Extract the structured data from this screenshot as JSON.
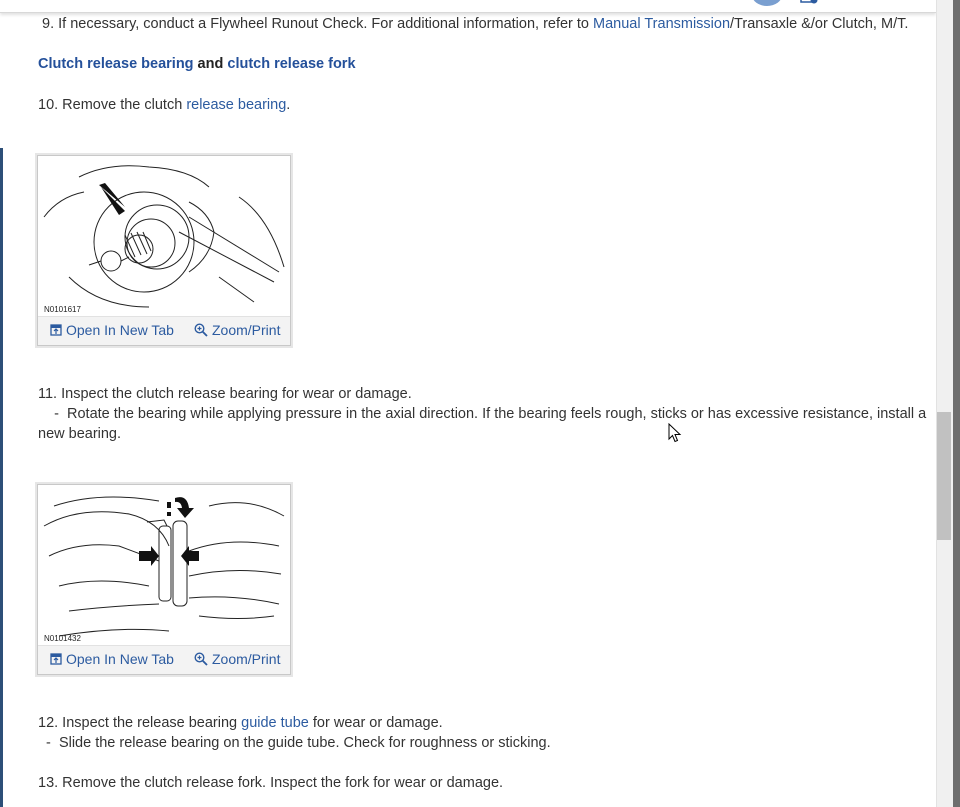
{
  "step9": {
    "prefix": " 9. If necessary, conduct a Flywheel Runout Check. For additional information, refer to ",
    "link": "Manual Transmission",
    "suffix": "/Transaxle &/or Clutch, M/T."
  },
  "heading": {
    "part1": "Clutch release bearing",
    "and": " and ",
    "part2": "clutch release fork"
  },
  "step10": {
    "prefix": "10. Remove the clutch ",
    "link": "release bearing",
    "suffix": "."
  },
  "figure1": {
    "code": "N0101617",
    "open_label": "Open In New Tab",
    "zoom_label": "Zoom/Print"
  },
  "step11": {
    "line1": "11. Inspect the clutch release bearing for wear or damage.",
    "line2": "    -  Rotate the bearing while applying pressure in the axial direction. If the bearing feels rough, sticks or has excessive resistance, install a",
    "line3": "new bearing."
  },
  "figure2": {
    "code": "N0101432",
    "open_label": "Open In New Tab",
    "zoom_label": "Zoom/Print"
  },
  "step12": {
    "prefix": "12. Inspect the release bearing ",
    "link": "guide tube",
    "suffix": " for wear or damage.",
    "sub": "  -  Slide the release bearing on the guide tube. Check for roughness or sticking."
  },
  "step13": {
    "text": "13. Remove the clutch release fork. Inspect the fork for wear or damage."
  },
  "colors": {
    "link": "#2c5ba0",
    "text": "#333333",
    "scroll_thumb": "#c1c1c1"
  },
  "icons": [
    "open-in-new-tab-icon",
    "zoom-icon",
    "mouse-cursor-icon"
  ]
}
